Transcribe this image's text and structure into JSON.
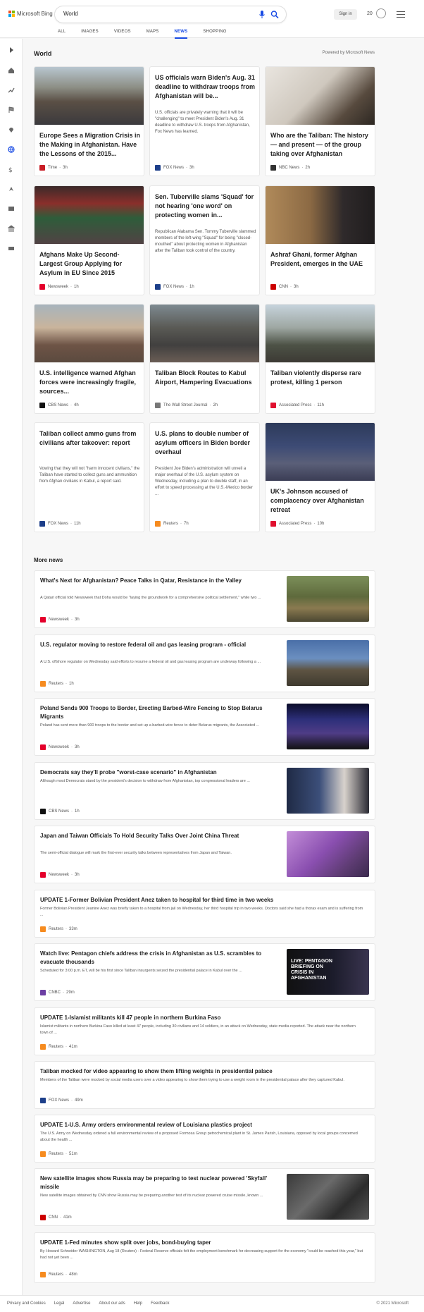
{
  "brand": "Microsoft Bing",
  "search": {
    "value": "World"
  },
  "header": {
    "signin": "Sign in",
    "points": "20"
  },
  "tabs": [
    "ALL",
    "IMAGES",
    "VIDEOS",
    "MAPS",
    "NEWS",
    "SHOPPING"
  ],
  "active_tab": "NEWS",
  "section": {
    "title": "World",
    "powered": "Powered by Microsoft News"
  },
  "cards": [
    {
      "title": "Europe Sees a Migration Crisis in the Making in Afghanistan. Have the Lessons of the 2015...",
      "source": "Time",
      "age": "3h",
      "color": "#c81d25",
      "img": "crowd"
    },
    {
      "title": "US officials warn Biden's Aug. 31 deadline to withdraw troops from Afghanistan will be...",
      "desc": "U.S. officials are privately warning that it will be \"challenging\" to meet President Biden's Aug. 31 deadline to withdraw U.S. troops from Afghanistan, Fox News has learned.",
      "source": "FOX News",
      "age": "3h",
      "color": "#1d3f8a"
    },
    {
      "title": "Who are the Taliban: The history — and present — of the group taking over Afghanistan",
      "source": "NBC News",
      "age": "2h",
      "color": "#333",
      "img": "turban"
    },
    {
      "title": "Afghans Make Up Second-Largest Group Applying for Asylum in EU Since 2015",
      "source": "Newsweek",
      "age": "1h",
      "color": "#e4002b",
      "img": "protest"
    },
    {
      "title": "Sen. Tuberville slams 'Squad' for not hearing 'one word' on protecting women in...",
      "desc": "Republican Alabama Sen. Tommy Tuberville slammed members of the left-wing \"Squad\" for being \"closed-mouthed\" about protecting women in Afghanistan after the Taliban took control of the country.",
      "source": "FOX News",
      "age": "1h",
      "color": "#1d3f8a"
    },
    {
      "title": "Ashraf Ghani, former Afghan President, emerges in the UAE",
      "source": "CNN",
      "age": "3h",
      "color": "#cc0000",
      "img": "portrait"
    },
    {
      "title": "U.S. intelligence warned Afghan forces were increasingly fragile, sources...",
      "source": "CBS News",
      "age": "4h",
      "color": "#111",
      "img": "men"
    },
    {
      "title": "Taliban Block Routes to Kabul Airport, Hampering Evacuations",
      "source": "The Wall Street Journal",
      "age": "2h",
      "color": "#777",
      "img": "airport"
    },
    {
      "title": "Taliban violently disperse rare protest, killing 1 person",
      "source": "Associated Press",
      "age": "11h",
      "color": "#e0102f",
      "img": "street"
    },
    {
      "title": "Taliban collect ammo guns from civilians after takeover: report",
      "desc": "Vowing that they will not \"harm innocent civilians,\" the Taliban have started to collect guns and ammunition from Afghan civilians in Kabul, a report said.",
      "source": "FOX News",
      "age": "11h",
      "color": "#1d3f8a"
    },
    {
      "title": "U.S. plans to double number of asylum officers in Biden border overhaul",
      "desc": "President Joe Biden's administration will unveil a major overhaul of the U.S. asylum system on Wednesday, including a plan to double staff, in an effort to speed processing at the U.S.-Mexico border ...",
      "source": "Reuters",
      "age": "7h",
      "color": "#f68b1f"
    },
    {
      "title": "UK's Johnson accused of complacency over Afghanistan retreat",
      "source": "Associated Press",
      "age": "10h",
      "color": "#e0102f",
      "img": "parliament"
    }
  ],
  "more_news": {
    "title": "More news",
    "items": [
      {
        "title": "What's Next for Afghanistan? Peace Talks in Qatar, Resistance in the Valley",
        "desc": "A Qatari official told Newsweek that Doha would be \"laying the groundwork for a comprehensive political settlement,\" while two ...",
        "source": "Newsweek",
        "age": "3h",
        "color": "#e4002b",
        "img": "tank"
      },
      {
        "title": "U.S. regulator moving to restore federal oil and gas leasing program - official",
        "desc": "A U.S. offshore regulator on Wednesday said efforts to resume a federal oil and gas leasing program are underway following a ...",
        "source": "Reuters",
        "age": "1h",
        "color": "#f68b1f",
        "img": "field"
      },
      {
        "title": "Poland Sends 900 Troops to Border, Erecting Barbed-Wire Fencing to Stop Belarus Migrants",
        "desc": "Poland has sent more than 900 troops to the border and set up a barbed-wire fence to deter Belarus migrants, the Associated ...",
        "source": "Newsweek",
        "age": "3h",
        "color": "#e4002b",
        "img": "night"
      },
      {
        "title": "Democrats say they'll probe \"worst-case scenario\" in Afghanistan",
        "desc": "Although most Democrats stand by the president's decision to withdraw from Afghanistan, top congressional leaders are ...",
        "source": "CBS News",
        "age": "1h",
        "color": "#111",
        "img": "suits"
      },
      {
        "title": "Japan and Taiwan Officials To Hold Security Talks Over Joint China Threat",
        "desc": "The semi-official dialogue will mark the first-ever security talks between representatives from Japan and Taiwan.",
        "source": "Newsweek",
        "age": "3h",
        "color": "#e4002b",
        "img": "purple"
      },
      {
        "title": "UPDATE 1-Former Bolivian President Anez taken to hospital for third time in two weeks",
        "desc": "Former Bolivian President Jeanine Anez was briefly taken to a hospital from jail on Wednesday, her third hospital trip in two weeks. Doctors said she had a thorax exam and is suffering from ...",
        "source": "Reuters",
        "age": "33m",
        "color": "#f68b1f"
      },
      {
        "title": "Watch live: Pentagon chiefs address the crisis in Afghanistan as U.S. scrambles to evacuate thousands",
        "desc": "Scheduled for 3:00 p.m. ET, will be his first since Taliban insurgents seized the presidential palace in Kabul over the ...",
        "source": "CNBC",
        "age": "29m",
        "color": "#6c3fa3",
        "img": "cnbc",
        "img_text": "LIVE: PENTAGON BRIEFING ON CRISIS IN AFGHANISTAN"
      },
      {
        "title": "UPDATE 1-Islamist militants kill 47 people in northern Burkina Faso",
        "desc": "Islamist militants in northern Burkina Faso killed at least 47 people, including 30 civilians and 14 soldiers, in an attack on Wednesday, state media reported. The attack near the northern town of ...",
        "source": "Reuters",
        "age": "41m",
        "color": "#f68b1f"
      },
      {
        "title": "Taliban mocked for video appearing to show them lifting weights in presidential palace",
        "desc": "Members of the Taliban were mocked by social media users over a video appearing to show them trying to use a weight room in the presidential palace after they captured Kabul.",
        "source": "FOX News",
        "age": "49m",
        "color": "#1d3f8a"
      },
      {
        "title": "UPDATE 1-U.S. Army orders environmental review of Louisiana plastics project",
        "desc": "The U.S. Army on Wednesday ordered a full environmental review of a proposed Formosa Group petrochemical plant in St. James Parish, Louisiana, opposed by local groups concerned about the health ...",
        "source": "Reuters",
        "age": "51m",
        "color": "#f68b1f"
      },
      {
        "title": "New satellite images show Russia may be preparing to test nuclear powered 'Skyfall' missile",
        "desc": "New satellite images obtained by CNN show Russia may be preparing another test of its nuclear powered cruise missile, known ...",
        "source": "CNN",
        "age": "41m",
        "color": "#cc0000",
        "img": "satellite"
      },
      {
        "title": "UPDATE 1-Fed minutes show split over jobs, bond-buying taper",
        "desc": "By Howard Schneider WASHINGTON, Aug 18 (Reuters) - Federal Reserve officials felt the employment benchmark for decreasing support for the economy \"could be reached this year,\" but had not yet been ...",
        "source": "Reuters",
        "age": "48m",
        "color": "#f68b1f"
      }
    ]
  },
  "footer": {
    "links": [
      "Privacy and Cookies",
      "Legal",
      "Advertise",
      "About our ads",
      "Help",
      "Feedback"
    ],
    "copyright": "© 2021 Microsoft"
  }
}
